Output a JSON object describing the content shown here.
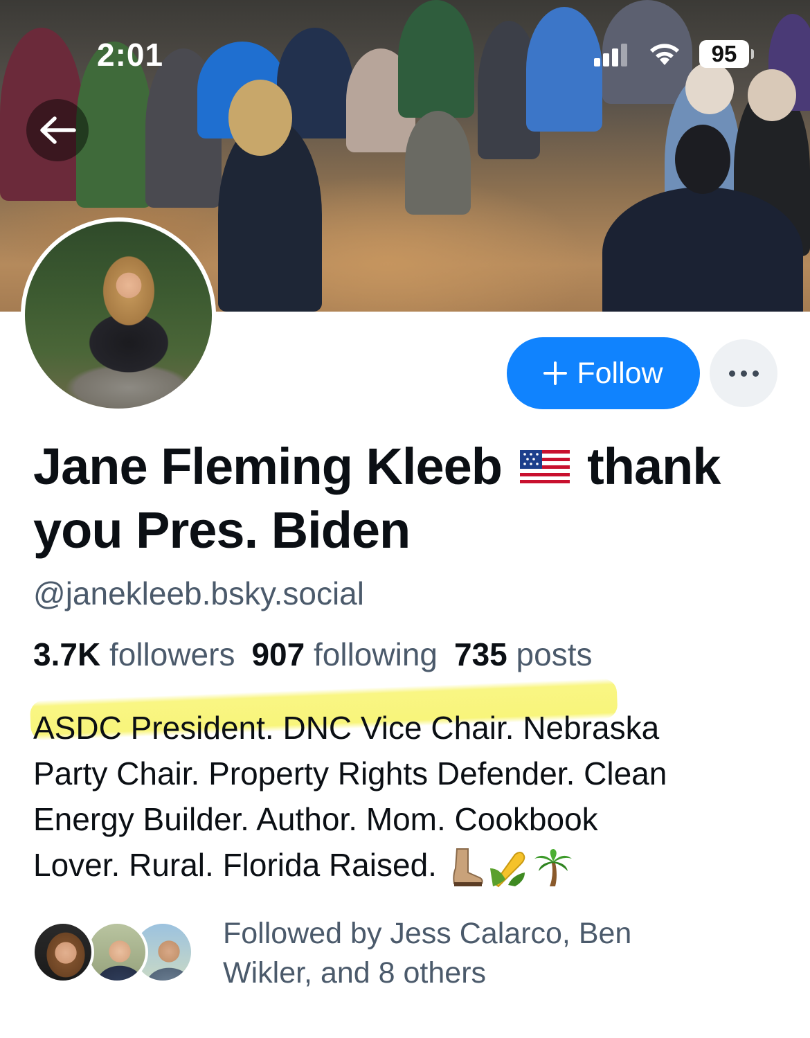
{
  "status_bar": {
    "time": "2:01",
    "battery": "95"
  },
  "profile": {
    "display_name": "Jane Fleming Kleeb",
    "display_name_rest": "thank you Pres. Biden",
    "handle": "@janekleeb.bsky.social",
    "stats": {
      "followers_count": "3.7K",
      "followers_label": "followers",
      "following_count": "907",
      "following_label": "following",
      "posts_count": "735",
      "posts_label": "posts"
    },
    "bio_line1": "ASDC President. DNC Vice Chair. Nebraska",
    "bio_line2": "Party Chair. Property Rights Defender. Clean",
    "bio_line3": "Energy Builder. Author. Mom. Cookbook",
    "bio_line4": "Lover. Rural.  Florida Raised.",
    "bio_emojis": [
      "boot-icon",
      "corn-icon",
      "palm-tree-icon"
    ]
  },
  "actions": {
    "follow_label": "Follow",
    "follow_icon": "plus-icon",
    "more_icon": "ellipsis-icon"
  },
  "followed_by": {
    "text": "Followed by Jess Calarco, Ben Wikler, and 8 others"
  },
  "colors": {
    "accent": "#1083fe",
    "secondary_text": "#4b5a6b",
    "highlight": "#f7f36a"
  }
}
